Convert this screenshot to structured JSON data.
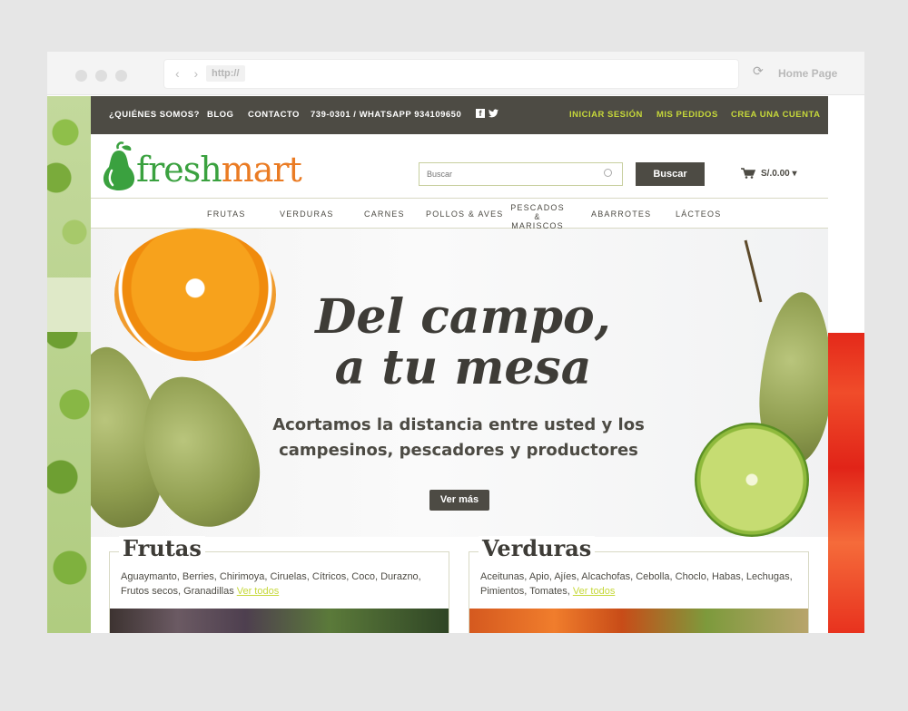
{
  "browser": {
    "url": "http://",
    "home_label": "Home Page"
  },
  "topbar": {
    "links": [
      "¿QUIÉNES SOMOS?",
      "BLOG",
      "CONTACTO"
    ],
    "phone": "739-0301 / WHATSAPP 934109650",
    "account_links": [
      "INICIAR SESIÓN",
      "MIS PEDIDOS",
      "CREA UNA CUENTA"
    ],
    "social_icons": [
      "facebook-icon",
      "twitter-icon"
    ]
  },
  "header": {
    "logo_fresh": "fresh",
    "logo_mart": "mart",
    "search_placeholder": "Buscar",
    "search_button": "Buscar",
    "cart_total": "S/.0.00"
  },
  "categories": [
    "FRUTAS",
    "VERDURAS",
    "CARNES",
    "POLLOS & AVES",
    "PESCADOS & MARISCOS",
    "ABARROTES",
    "LÁCTEOS"
  ],
  "hero": {
    "title_line1": "Del campo,",
    "title_line2": "a tu mesa",
    "subtitle_line1": "Acortamos la distancia entre usted y los",
    "subtitle_line2": "campesinos, pescadores y productores",
    "button": "Ver más"
  },
  "cards": [
    {
      "title": "Frutas",
      "text": "Aguaymanto, Berries, Chirimoya, Ciruelas, Cítricos, Coco, Durazno, Frutos secos, Granadillas",
      "link": "Ver todos"
    },
    {
      "title": "Verduras",
      "text": "Aceitunas, Apio, Ajíes, Alcachofas, Cebolla, Choclo, Habas, Lechugas, Pimientos, Tomates,",
      "link": "Ver todos"
    }
  ],
  "colors": {
    "dark": "#4d4b44",
    "accent_green": "#c6d83a",
    "logo_green": "#3aa13f",
    "logo_orange": "#ea7b23"
  }
}
